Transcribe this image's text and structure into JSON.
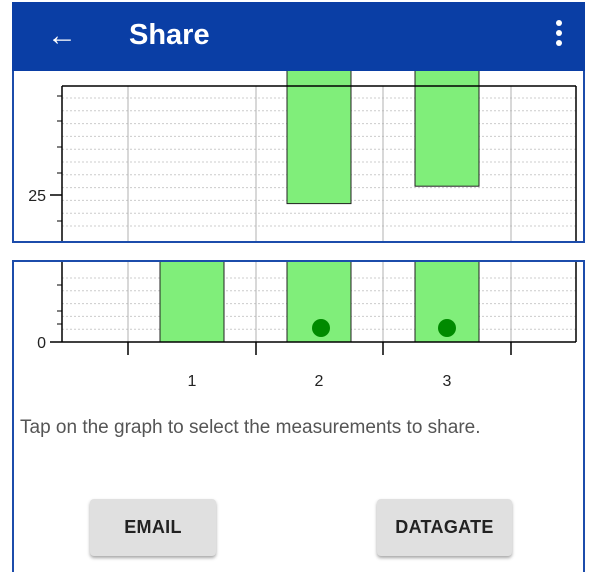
{
  "appbar": {
    "title": "Share",
    "back_icon": "arrow-left-icon",
    "menu_icon": "more-vert-icon",
    "color": "#0a3ea5"
  },
  "chart_data": {
    "type": "bar",
    "categories": [
      "1",
      "2",
      "3"
    ],
    "values": [
      12,
      58,
      61
    ],
    "selected": [
      false,
      true,
      true
    ],
    "y_tick_labels_visible": [
      "25",
      "0"
    ],
    "bar_color": "#80ee7a",
    "selection_marker_color": "#008a00",
    "grid": true
  },
  "hint_text": "Tap on the graph to select the measurements to share.",
  "buttons": {
    "email": "EMAIL",
    "datagate": "DATAGATE"
  }
}
